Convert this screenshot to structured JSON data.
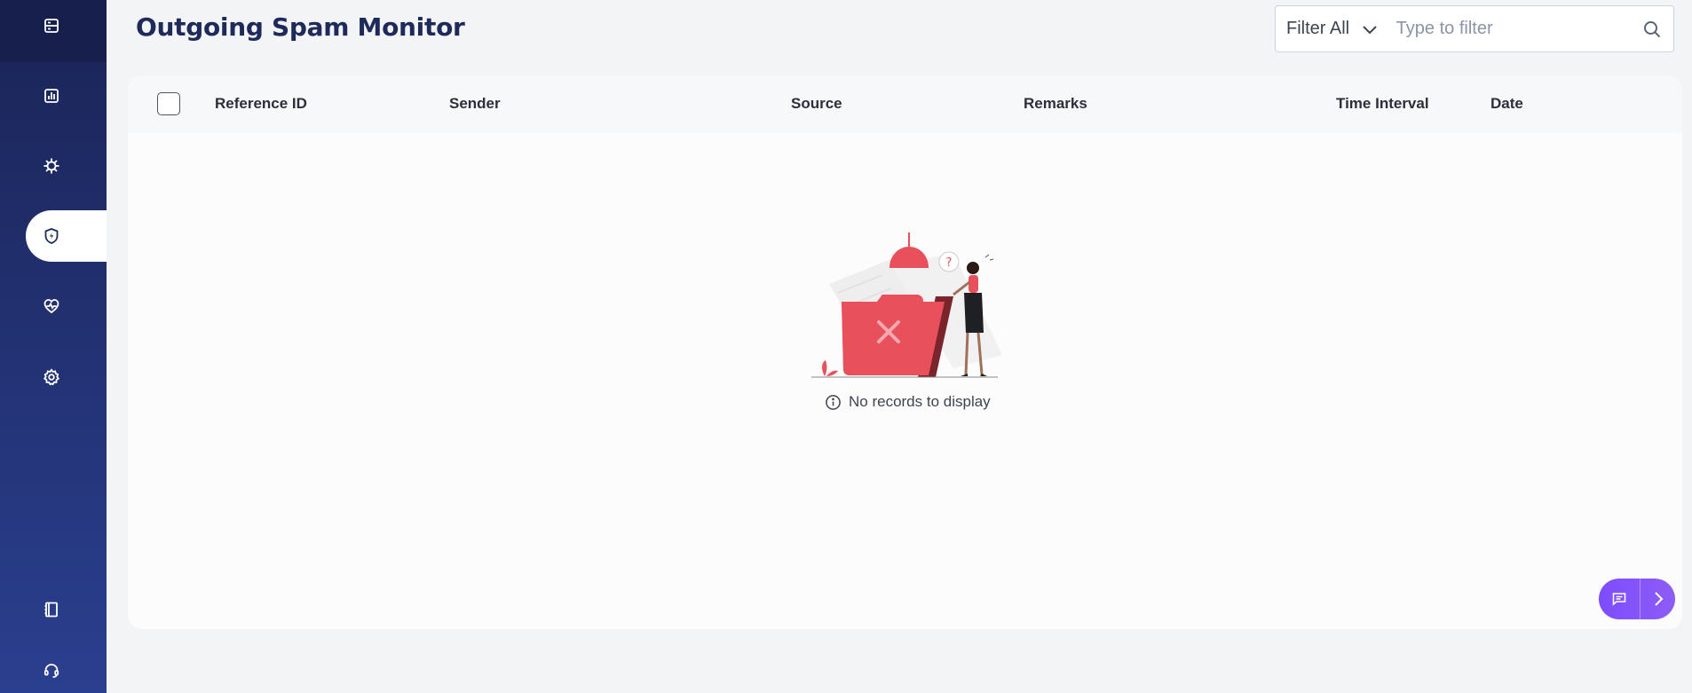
{
  "page": {
    "title": "Outgoing Spam Monitor"
  },
  "sidebar": {
    "items": [
      {
        "icon": "list-icon",
        "label": "Overview"
      },
      {
        "icon": "chart-icon",
        "label": "Reports"
      },
      {
        "icon": "virus-icon",
        "label": "Threats"
      },
      {
        "icon": "shield-bolt-icon",
        "label": "Spam Monitor",
        "active": true
      },
      {
        "icon": "heart-pulse-icon",
        "label": "Health"
      },
      {
        "icon": "gear-icon",
        "label": "Settings"
      },
      {
        "icon": "book-icon",
        "label": "Docs"
      },
      {
        "icon": "headset-icon",
        "label": "Support"
      }
    ]
  },
  "filter": {
    "selected": "Filter All",
    "placeholder": "Type to filter"
  },
  "table": {
    "columns": [
      "Reference ID",
      "Sender",
      "Source",
      "Remarks",
      "Time Interval",
      "Date"
    ],
    "rows": []
  },
  "empty_state": {
    "message": "No records to display"
  },
  "colors": {
    "sidebar": "#223070",
    "title": "#1e2a5a",
    "accent": "#e8505b",
    "chat": "#7c4dff"
  }
}
